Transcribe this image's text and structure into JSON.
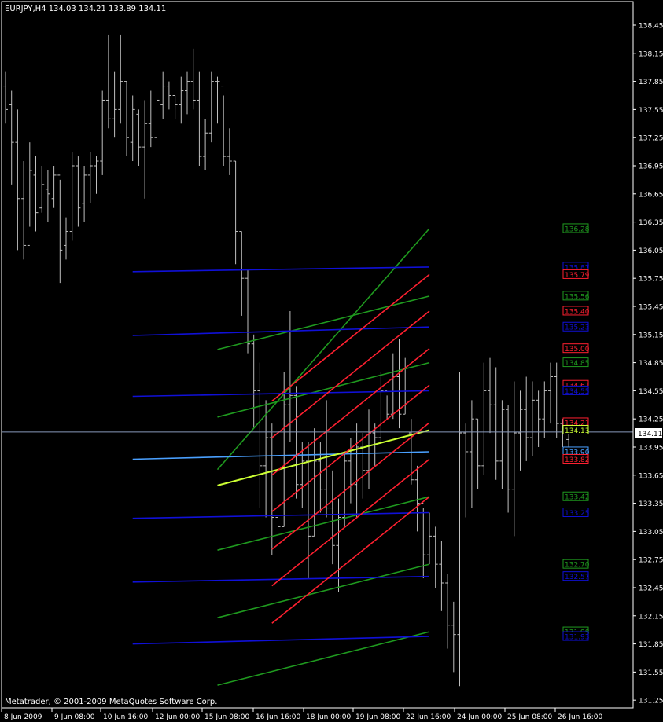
{
  "window_title": "EURJPY,H4  134.03 134.21 133.89 134.11",
  "copyright": "Metatrader, © 2001-2009 MetaQuotes Software Corp.",
  "colors": {
    "background": "#000000",
    "axis": "#ffffff",
    "candle": "#c0c0c0",
    "blue_line": "#1010d8",
    "light_blue_line": "#4aa0ff",
    "green_line": "#1f9a1f",
    "red_line": "#ff2030",
    "yellow_line": "#ccff33",
    "price_line": "#8899bb"
  },
  "chart_data": {
    "type": "line",
    "symbol": "EURJPY",
    "timeframe": "H4",
    "ylim": [
      131.15,
      138.6
    ],
    "y_ticks": [
      "138.45",
      "138.15",
      "137.85",
      "137.55",
      "137.25",
      "136.95",
      "136.65",
      "136.35",
      "136.05",
      "135.75",
      "135.45",
      "135.15",
      "134.85",
      "134.55",
      "134.25",
      "133.95",
      "133.65",
      "133.35",
      "133.05",
      "132.75",
      "132.45",
      "132.15",
      "131.85",
      "131.55",
      "131.25"
    ],
    "x_ticks": [
      "8 Jun 2009",
      "9 Jun 08:00",
      "10 Jun 16:00",
      "12 Jun 00:00",
      "15 Jun 08:00",
      "16 Jun 16:00",
      "18 Jun 00:00",
      "19 Jun 08:00",
      "22 Jun 16:00",
      "24 Jun 00:00",
      "25 Jun 08:00",
      "26 Jun 16:00"
    ],
    "current_price": "134.11",
    "candles": [
      {
        "h": 137.95,
        "l": 137.4,
        "o": 137.8,
        "c": 137.55
      },
      {
        "h": 137.75,
        "l": 136.75,
        "o": 137.6,
        "c": 137.2
      },
      {
        "h": 137.55,
        "l": 136.05,
        "o": 137.2,
        "c": 136.6
      },
      {
        "h": 137.0,
        "l": 135.95,
        "o": 136.6,
        "c": 136.1
      },
      {
        "h": 137.2,
        "l": 136.3,
        "o": 136.1,
        "c": 136.9
      },
      {
        "h": 137.05,
        "l": 136.25,
        "o": 136.85,
        "c": 136.45
      },
      {
        "h": 136.95,
        "l": 136.45,
        "o": 136.5,
        "c": 136.75
      },
      {
        "h": 136.9,
        "l": 136.35,
        "o": 136.7,
        "c": 136.65
      },
      {
        "h": 136.95,
        "l": 136.5,
        "o": 136.6,
        "c": 136.85
      },
      {
        "h": 136.8,
        "l": 135.7,
        "o": 136.85,
        "c": 136.05
      },
      {
        "h": 136.4,
        "l": 135.95,
        "o": 136.1,
        "c": 136.25
      },
      {
        "h": 137.1,
        "l": 136.15,
        "o": 136.25,
        "c": 136.95
      },
      {
        "h": 137.05,
        "l": 136.3,
        "o": 136.95,
        "c": 136.5
      },
      {
        "h": 136.95,
        "l": 136.35,
        "o": 136.55,
        "c": 136.85
      },
      {
        "h": 137.1,
        "l": 136.55,
        "o": 136.85,
        "c": 136.95
      },
      {
        "h": 137.05,
        "l": 136.65,
        "o": 136.95,
        "c": 137.0
      },
      {
        "h": 137.75,
        "l": 136.85,
        "o": 137.0,
        "c": 137.65
      },
      {
        "h": 138.35,
        "l": 137.35,
        "o": 137.65,
        "c": 137.45
      },
      {
        "h": 137.95,
        "l": 137.25,
        "o": 137.45,
        "c": 137.55
      },
      {
        "h": 138.35,
        "l": 137.4,
        "o": 137.55,
        "c": 137.85
      },
      {
        "h": 137.85,
        "l": 137.05,
        "o": 137.85,
        "c": 137.25
      },
      {
        "h": 137.7,
        "l": 137.0,
        "o": 137.2,
        "c": 137.55
      },
      {
        "h": 137.55,
        "l": 136.95,
        "o": 137.5,
        "c": 137.15
      },
      {
        "h": 137.65,
        "l": 136.6,
        "o": 137.15,
        "c": 137.4
      },
      {
        "h": 137.75,
        "l": 137.15,
        "o": 137.4,
        "c": 137.25
      },
      {
        "h": 137.85,
        "l": 137.35,
        "o": 137.25,
        "c": 137.65
      },
      {
        "h": 137.95,
        "l": 137.45,
        "o": 137.6,
        "c": 137.8
      },
      {
        "h": 137.85,
        "l": 137.55,
        "o": 137.8,
        "c": 137.7
      },
      {
        "h": 137.7,
        "l": 137.45,
        "o": 137.7,
        "c": 137.6
      },
      {
        "h": 137.9,
        "l": 137.4,
        "o": 137.6,
        "c": 137.75
      },
      {
        "h": 137.95,
        "l": 137.5,
        "o": 137.75,
        "c": 137.85
      },
      {
        "h": 138.2,
        "l": 137.55,
        "o": 137.85,
        "c": 137.65
      },
      {
        "h": 137.95,
        "l": 136.95,
        "o": 137.65,
        "c": 137.05
      },
      {
        "h": 137.45,
        "l": 136.9,
        "o": 137.05,
        "c": 137.3
      },
      {
        "h": 137.95,
        "l": 137.2,
        "o": 137.3,
        "c": 137.85
      },
      {
        "h": 137.9,
        "l": 137.4,
        "o": 137.85,
        "c": 137.85
      },
      {
        "h": 137.7,
        "l": 136.95,
        "o": 137.8,
        "c": 137.05
      },
      {
        "h": 137.35,
        "l": 136.85,
        "o": 137.05,
        "c": 137.0
      },
      {
        "h": 137.0,
        "l": 135.9,
        "o": 137.0,
        "c": 136.25
      },
      {
        "h": 136.25,
        "l": 135.35,
        "o": 136.25,
        "c": 135.75
      },
      {
        "h": 135.85,
        "l": 134.95,
        "o": 135.75,
        "c": 135.05
      },
      {
        "h": 135.15,
        "l": 134.15,
        "o": 135.05,
        "c": 134.55
      },
      {
        "h": 134.85,
        "l": 133.3,
        "o": 134.55,
        "c": 133.75
      },
      {
        "h": 134.45,
        "l": 133.2,
        "o": 133.75,
        "c": 134.05
      },
      {
        "h": 134.2,
        "l": 132.8,
        "o": 134.05,
        "c": 133.2
      },
      {
        "h": 133.5,
        "l": 132.7,
        "o": 133.2,
        "c": 133.1
      },
      {
        "h": 134.75,
        "l": 133.1,
        "o": 133.1,
        "c": 134.4
      },
      {
        "h": 135.4,
        "l": 134.0,
        "o": 134.4,
        "c": 134.5
      },
      {
        "h": 134.6,
        "l": 133.4,
        "o": 134.5,
        "c": 133.55
      },
      {
        "h": 134.0,
        "l": 133.3,
        "o": 133.55,
        "c": 133.8
      },
      {
        "h": 134.0,
        "l": 132.55,
        "o": 133.8,
        "c": 133.0
      },
      {
        "h": 134.15,
        "l": 133.0,
        "o": 133.0,
        "c": 133.8
      },
      {
        "h": 134.0,
        "l": 133.25,
        "o": 133.8,
        "c": 133.5
      },
      {
        "h": 134.45,
        "l": 133.2,
        "o": 133.5,
        "c": 133.3
      },
      {
        "h": 133.7,
        "l": 132.7,
        "o": 133.3,
        "c": 132.9
      },
      {
        "h": 133.4,
        "l": 132.4,
        "o": 132.9,
        "c": 133.2
      },
      {
        "h": 133.9,
        "l": 133.1,
        "o": 133.2,
        "c": 133.8
      },
      {
        "h": 134.05,
        "l": 133.35,
        "o": 133.8,
        "c": 133.55
      },
      {
        "h": 134.2,
        "l": 133.2,
        "o": 133.55,
        "c": 133.95
      },
      {
        "h": 134.1,
        "l": 133.4,
        "o": 133.95,
        "c": 133.7
      },
      {
        "h": 134.35,
        "l": 133.5,
        "o": 133.7,
        "c": 134.1
      },
      {
        "h": 134.2,
        "l": 133.75,
        "o": 134.1,
        "c": 134.05
      },
      {
        "h": 134.75,
        "l": 134.0,
        "o": 134.05,
        "c": 134.55
      },
      {
        "h": 134.5,
        "l": 134.25,
        "o": 134.55,
        "c": 134.3
      },
      {
        "h": 134.95,
        "l": 134.25,
        "o": 134.3,
        "c": 134.7
      },
      {
        "h": 135.1,
        "l": 134.15,
        "o": 134.7,
        "c": 134.3
      },
      {
        "h": 134.9,
        "l": 134.3,
        "o": 134.3,
        "c": 134.75
      },
      {
        "h": 134.25,
        "l": 133.55,
        "o": 134.1,
        "c": 133.6
      },
      {
        "h": 133.75,
        "l": 133.05,
        "o": 133.6,
        "c": 133.35
      },
      {
        "h": 133.3,
        "l": 132.55,
        "o": 133.35,
        "c": 132.8
      },
      {
        "h": 133.25,
        "l": 132.7,
        "o": 132.8,
        "c": 133.0
      },
      {
        "h": 133.1,
        "l": 132.45,
        "o": 133.0,
        "c": 132.7
      },
      {
        "h": 132.95,
        "l": 132.2,
        "o": 132.7,
        "c": 132.5
      },
      {
        "h": 132.6,
        "l": 131.8,
        "o": 132.5,
        "c": 132.05
      },
      {
        "h": 132.3,
        "l": 131.55,
        "o": 132.05,
        "c": 131.95
      },
      {
        "h": 134.75,
        "l": 131.4,
        "o": 131.95,
        "c": 134.1
      },
      {
        "h": 134.2,
        "l": 133.2,
        "o": 134.1,
        "c": 133.9
      },
      {
        "h": 134.45,
        "l": 133.3,
        "o": 133.9,
        "c": 134.25
      },
      {
        "h": 134.25,
        "l": 133.5,
        "o": 134.25,
        "c": 133.75
      },
      {
        "h": 134.85,
        "l": 133.65,
        "o": 133.75,
        "c": 134.55
      },
      {
        "h": 134.9,
        "l": 134.1,
        "o": 134.55,
        "c": 134.4
      },
      {
        "h": 134.8,
        "l": 133.6,
        "o": 134.4,
        "c": 133.8
      },
      {
        "h": 134.45,
        "l": 133.5,
        "o": 133.8,
        "c": 134.35
      },
      {
        "h": 134.4,
        "l": 133.25,
        "o": 134.35,
        "c": 133.5
      },
      {
        "h": 134.65,
        "l": 133.0,
        "o": 133.5,
        "c": 134.1
      },
      {
        "h": 134.55,
        "l": 133.7,
        "o": 134.1,
        "c": 134.35
      },
      {
        "h": 134.7,
        "l": 133.8,
        "o": 134.35,
        "c": 134.05
      },
      {
        "h": 134.65,
        "l": 133.85,
        "o": 134.05,
        "c": 134.45
      },
      {
        "h": 134.55,
        "l": 133.95,
        "o": 134.45,
        "c": 134.25
      },
      {
        "h": 134.65,
        "l": 134.05,
        "o": 134.25,
        "c": 134.55
      },
      {
        "h": 134.85,
        "l": 134.2,
        "o": 134.55,
        "c": 134.7
      },
      {
        "h": 134.85,
        "l": 134.05,
        "o": 134.7,
        "c": 134.2
      },
      {
        "h": 134.25,
        "l": 133.95,
        "o": 134.2,
        "c": 134.1
      },
      {
        "h": 134.21,
        "l": 133.89,
        "o": 134.03,
        "c": 134.11
      }
    ],
    "series": [
      {
        "color": "green",
        "points": [
          [
            35,
            133.71
          ],
          [
            70,
            136.28
          ]
        ]
      },
      {
        "color": "green",
        "points": [
          [
            35,
            134.99
          ],
          [
            70,
            135.56
          ]
        ]
      },
      {
        "color": "green",
        "points": [
          [
            35,
            134.27
          ],
          [
            70,
            134.85
          ]
        ]
      },
      {
        "color": "green",
        "points": [
          [
            35,
            132.85
          ],
          [
            70,
            133.42
          ]
        ]
      },
      {
        "color": "green",
        "points": [
          [
            35,
            132.13
          ],
          [
            70,
            132.7
          ]
        ]
      },
      {
        "color": "green",
        "points": [
          [
            35,
            131.41
          ],
          [
            70,
            131.98
          ]
        ]
      },
      {
        "color": "blue",
        "points": [
          [
            21,
            135.82
          ],
          [
            70,
            135.87
          ]
        ]
      },
      {
        "color": "blue",
        "points": [
          [
            21,
            135.14
          ],
          [
            70,
            135.23
          ]
        ]
      },
      {
        "color": "blue",
        "points": [
          [
            21,
            134.49
          ],
          [
            70,
            134.55
          ]
        ]
      },
      {
        "color": "blue",
        "points": [
          [
            21,
            133.19
          ],
          [
            70,
            133.25
          ]
        ]
      },
      {
        "color": "blue",
        "points": [
          [
            21,
            132.51
          ],
          [
            70,
            132.57
          ]
        ]
      },
      {
        "color": "blue",
        "points": [
          [
            21,
            131.85
          ],
          [
            70,
            131.93
          ]
        ]
      },
      {
        "color": "light_blue",
        "points": [
          [
            21,
            133.82
          ],
          [
            70,
            133.9
          ]
        ]
      },
      {
        "color": "yellow",
        "points": [
          [
            35,
            133.54
          ],
          [
            70,
            134.13
          ]
        ]
      },
      {
        "color": "red",
        "points": [
          [
            44,
            134.44
          ],
          [
            70,
            135.79
          ]
        ]
      },
      {
        "color": "red",
        "points": [
          [
            44,
            134.05
          ],
          [
            70,
            135.4
          ]
        ]
      },
      {
        "color": "red",
        "points": [
          [
            44,
            133.65
          ],
          [
            70,
            135.0
          ]
        ]
      },
      {
        "color": "red",
        "points": [
          [
            44,
            133.26
          ],
          [
            70,
            134.61
          ]
        ]
      },
      {
        "color": "red",
        "points": [
          [
            44,
            132.86
          ],
          [
            70,
            134.21
          ]
        ]
      },
      {
        "color": "red",
        "points": [
          [
            44,
            132.47
          ],
          [
            70,
            133.82
          ]
        ]
      },
      {
        "color": "red",
        "points": [
          [
            44,
            132.07
          ],
          [
            70,
            133.42
          ]
        ]
      }
    ],
    "price_labels": [
      {
        "text": "136.28",
        "color": "green"
      },
      {
        "text": "135.87",
        "color": "blue"
      },
      {
        "text": "135.79",
        "color": "red"
      },
      {
        "text": "135.56",
        "color": "green"
      },
      {
        "text": "135.40",
        "color": "red"
      },
      {
        "text": "135.23",
        "color": "blue"
      },
      {
        "text": "135.00",
        "color": "red"
      },
      {
        "text": "134.85",
        "color": "green"
      },
      {
        "text": "134.61",
        "color": "red"
      },
      {
        "text": "134.55",
        "color": "blue"
      },
      {
        "text": "134.21",
        "color": "red"
      },
      {
        "text": "134.13",
        "color": "yellow"
      },
      {
        "text": "133.90",
        "color": "light_blue"
      },
      {
        "text": "133.82",
        "color": "red"
      },
      {
        "text": "133.42",
        "color": "green"
      },
      {
        "text": "133.25",
        "color": "blue"
      },
      {
        "text": "132.70",
        "color": "green"
      },
      {
        "text": "132.57",
        "color": "blue"
      },
      {
        "text": "131.98",
        "color": "green"
      },
      {
        "text": "131.93",
        "color": "blue"
      }
    ]
  }
}
